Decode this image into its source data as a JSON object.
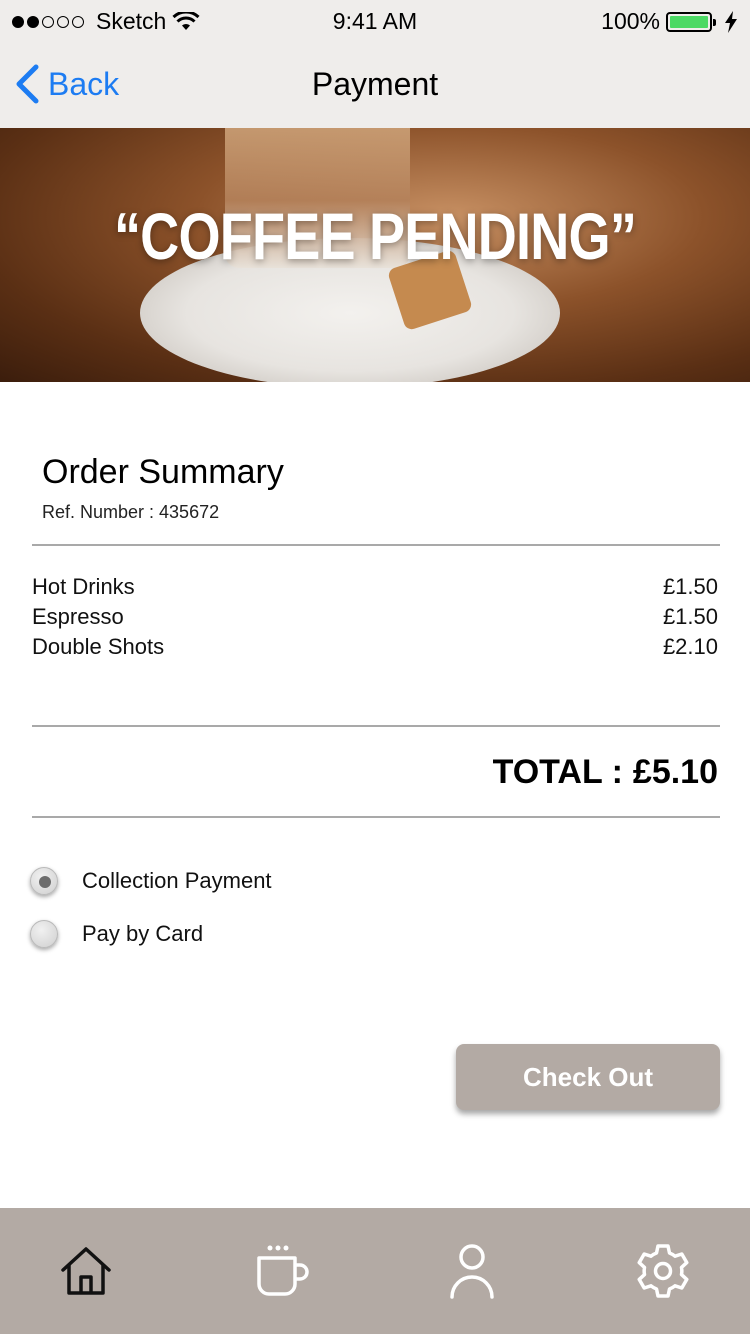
{
  "status_bar": {
    "carrier": "Sketch",
    "time": "9:41 AM",
    "battery": "100%",
    "signal_dots_filled": 2,
    "signal_dots_total": 5
  },
  "nav": {
    "back_label": "Back",
    "title": "Payment"
  },
  "hero": {
    "text": "“COFFEE PENDING”"
  },
  "order": {
    "title": "Order Summary",
    "ref_label": "Ref. Number : 435672",
    "items": [
      {
        "name": "Hot Drinks",
        "price": "£1.50"
      },
      {
        "name": "Espresso",
        "price": "£1.50"
      },
      {
        "name": "Double Shots",
        "price": "£2.10"
      }
    ],
    "total_label": "TOTAL :",
    "total_value": "£5.10"
  },
  "payment_options": [
    {
      "label": "Collection Payment",
      "selected": true
    },
    {
      "label": "Pay by Card",
      "selected": false
    }
  ],
  "checkout_label": "Check Out",
  "tabs": [
    {
      "icon": "home-icon"
    },
    {
      "icon": "coffee-cup-icon"
    },
    {
      "icon": "person-icon"
    },
    {
      "icon": "gear-icon"
    }
  ],
  "colors": {
    "accent_blue": "#1d7cf2",
    "tabbar": "#b3aaa4",
    "battery_green": "#4cd964"
  }
}
